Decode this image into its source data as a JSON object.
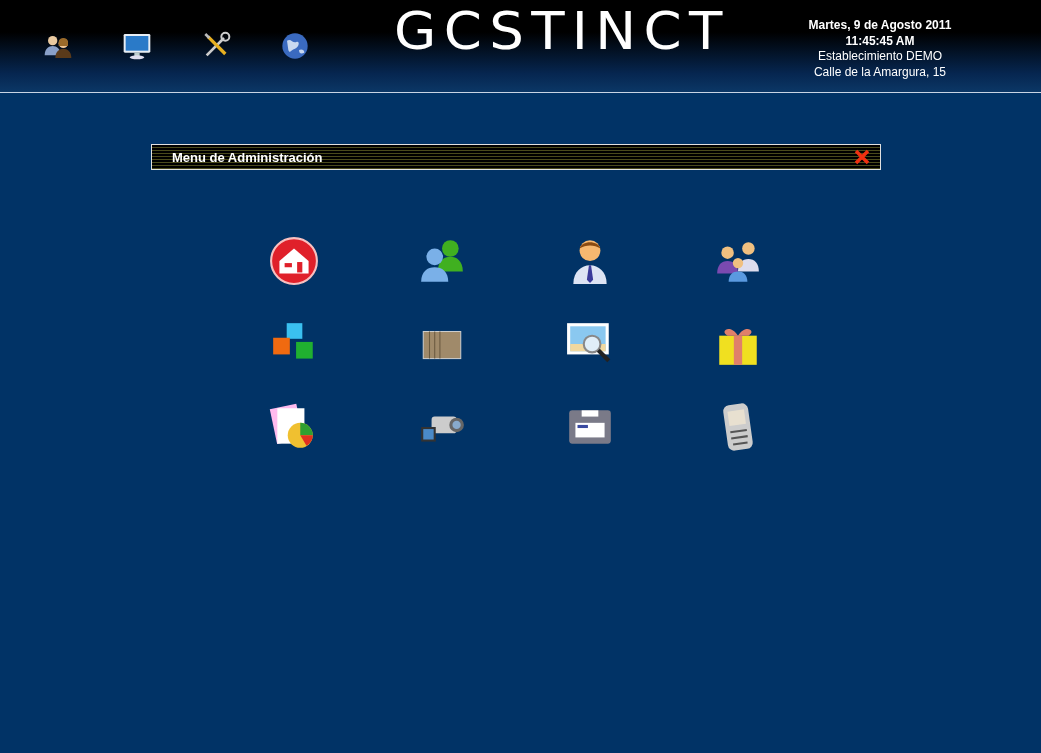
{
  "header": {
    "nav": [
      {
        "kind": "users"
      },
      {
        "kind": "monitor"
      },
      {
        "kind": "tools"
      },
      {
        "kind": "globe"
      }
    ],
    "logo": "GCSTINCT",
    "info": {
      "date": "Martes, 9 de Agosto 2011",
      "time": "11:45:45 AM",
      "establishment": "Establecimiento DEMO",
      "address": "Calle de la Amargura, 15"
    }
  },
  "panel": {
    "title": "Menu de Administración"
  },
  "grid": [
    {
      "kind": "home"
    },
    {
      "kind": "user-pair"
    },
    {
      "kind": "user"
    },
    {
      "kind": "family"
    },
    {
      "kind": "cubes"
    },
    {
      "kind": "archive"
    },
    {
      "kind": "image-search"
    },
    {
      "kind": "gift"
    },
    {
      "kind": "report"
    },
    {
      "kind": "camera"
    },
    {
      "kind": "drive"
    },
    {
      "kind": "phone"
    }
  ]
}
